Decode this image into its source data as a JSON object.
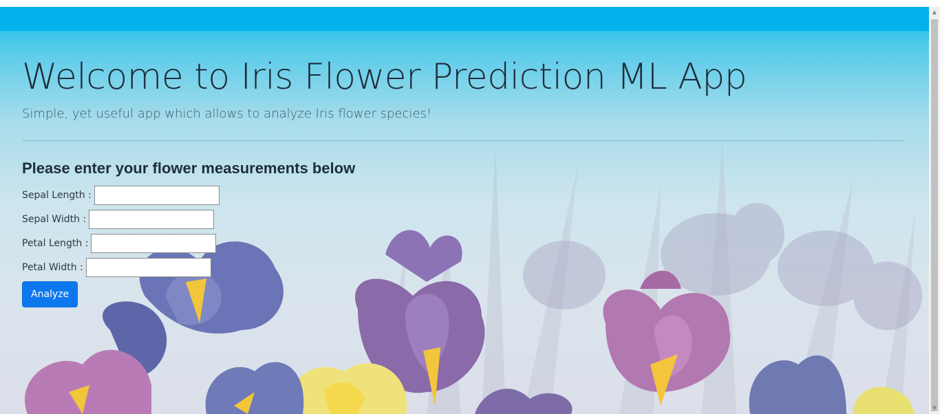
{
  "header": {
    "title": "Welcome to Iris Flower Prediction ML App",
    "subtitle": "Simple, yet useful app which allows to analyze Iris flower species!"
  },
  "form": {
    "heading": "Please enter your flower measurements below",
    "fields": [
      {
        "label": "Sepal Length :",
        "value": "",
        "placeholder": ""
      },
      {
        "label": "Sepal Width :",
        "value": "",
        "placeholder": ""
      },
      {
        "label": "Petal Length :",
        "value": "",
        "placeholder": ""
      },
      {
        "label": "Petal Width :",
        "value": "",
        "placeholder": ""
      }
    ],
    "submit_label": "Analyze"
  },
  "colors": {
    "topbar": "#04b1ea",
    "button": "#0d78ee",
    "text": "#1f2d3a"
  }
}
